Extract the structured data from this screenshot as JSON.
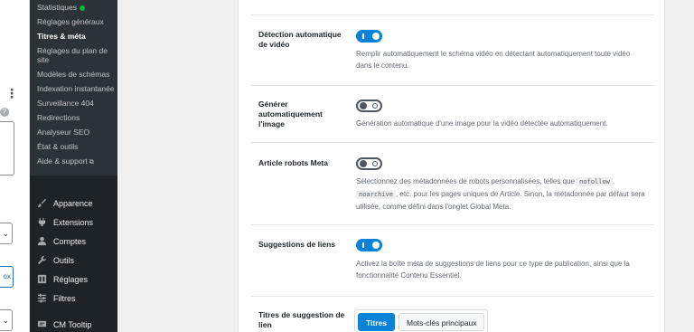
{
  "left_panel": {
    "help_text": "t",
    "help_icon": "?",
    "select1_value": "",
    "button_text": "ox",
    "kebab": "⋮"
  },
  "sidebar": {
    "submenu": [
      {
        "label": "Statistiques",
        "badge": "green-dot"
      },
      {
        "label": "Réglages généraux"
      },
      {
        "label": "Titres & méta",
        "active": true
      },
      {
        "label": "Réglages du plan de site"
      },
      {
        "label": "Modèles de schémas"
      },
      {
        "label": "Indexation instantanée"
      },
      {
        "label": "Surveillance 404"
      },
      {
        "label": "Redirections"
      },
      {
        "label": "Analyseur SEO"
      },
      {
        "label": "État & outils"
      },
      {
        "label": "Aide & support",
        "icon": "external-link-icon"
      }
    ],
    "menu": [
      {
        "label": "Apparence",
        "icon": "paintbrush-icon"
      },
      {
        "label": "Extensions",
        "icon": "plugin-icon"
      },
      {
        "label": "Comptes",
        "icon": "user-icon"
      },
      {
        "label": "Outils",
        "icon": "wrench-icon"
      },
      {
        "label": "Réglages",
        "icon": "settings-icon"
      },
      {
        "label": "Filtres",
        "icon": "sliders-icon"
      },
      {
        "label": "CM Tooltip",
        "icon": "tooltip-icon"
      }
    ]
  },
  "settings": {
    "video_detection": {
      "label": "Détection automatique de vidéo",
      "enabled": true,
      "description": "Remplir automatiquement le schéma vidéo en détectant automatiquement toute vidéo dans le contenu."
    },
    "auto_image": {
      "label": "Générer automatiquement l'image",
      "enabled": false,
      "description": "Génération automatique d'une image pour la vidéo détectée automatiquement."
    },
    "robots_meta": {
      "label": "Article robots Meta",
      "enabled": false,
      "desc_part1": "Sélectionnez des métadonnées de robots personnalisées, telles que",
      "code1": "nofollow",
      "desc_sep": ",",
      "code2": "noarchive",
      "desc_part2": ", etc. pour les pages uniques de Article. Sinon, la métadonnée par défaut sera utilisée, comme défini dans l'onglet Global Meta."
    },
    "link_suggestions": {
      "label": "Suggestions de liens",
      "enabled": true,
      "description": "Activez la boîte méta de suggestions de liens pour ce type de publication, ainsi que la fonctionnalité Contenu Essentiel."
    },
    "suggestion_titles": {
      "label": "Titres de suggestion de lien",
      "options": [
        "Titres",
        "Mots-clés principaux"
      ],
      "selected": "Titres"
    }
  },
  "colors": {
    "accent": "#0a82d8",
    "sidebar_bg": "#1d2327",
    "submenu_bg": "#2c3338"
  }
}
